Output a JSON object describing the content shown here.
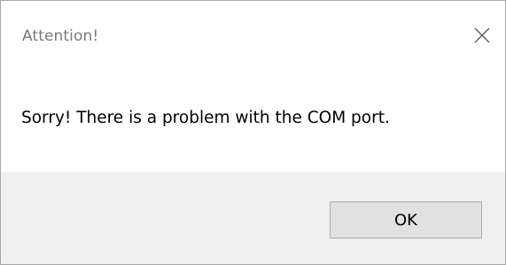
{
  "window": {
    "title": "Attention!",
    "close_icon": "close-icon"
  },
  "dialog": {
    "message": "Sorry! There is a problem with the COM port."
  },
  "buttons": {
    "ok_label": "OK"
  },
  "colors": {
    "title_text": "#7a7a7a",
    "footer_background": "#f0f0f0",
    "button_background": "#e1e1e1",
    "button_border": "#adadad",
    "window_border": "#a8a8a8"
  }
}
